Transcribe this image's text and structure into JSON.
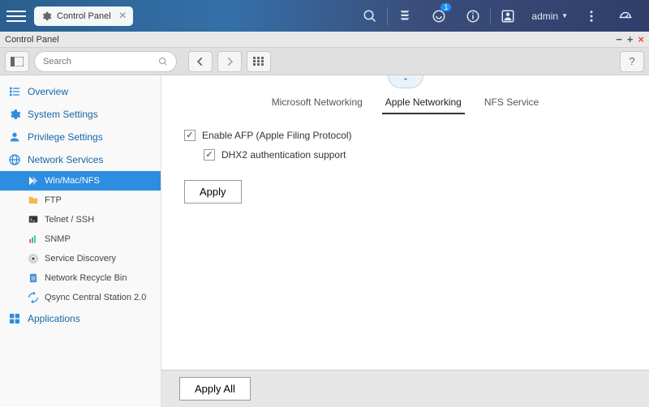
{
  "topbar": {
    "tab_label": "Control Panel",
    "user_menu": "admin",
    "notification_badge": "1"
  },
  "window": {
    "title": "Control Panel"
  },
  "toolbar": {
    "search_placeholder": "Search"
  },
  "sidebar": {
    "items": [
      {
        "label": "Overview"
      },
      {
        "label": "System Settings"
      },
      {
        "label": "Privilege Settings"
      },
      {
        "label": "Network Services"
      },
      {
        "label": "Applications"
      }
    ],
    "subitems": [
      {
        "label": "Win/Mac/NFS"
      },
      {
        "label": "FTP"
      },
      {
        "label": "Telnet / SSH"
      },
      {
        "label": "SNMP"
      },
      {
        "label": "Service Discovery"
      },
      {
        "label": "Network Recycle Bin"
      },
      {
        "label": "Qsync Central Station 2.0"
      }
    ]
  },
  "main": {
    "tabs": [
      {
        "label": "Microsoft Networking"
      },
      {
        "label": "Apple Networking"
      },
      {
        "label": "NFS Service"
      }
    ],
    "options": {
      "enable_afp": "Enable AFP (Apple Filing Protocol)",
      "dhx2": "DHX2 authentication support"
    },
    "apply_label": "Apply",
    "apply_all_label": "Apply All"
  }
}
